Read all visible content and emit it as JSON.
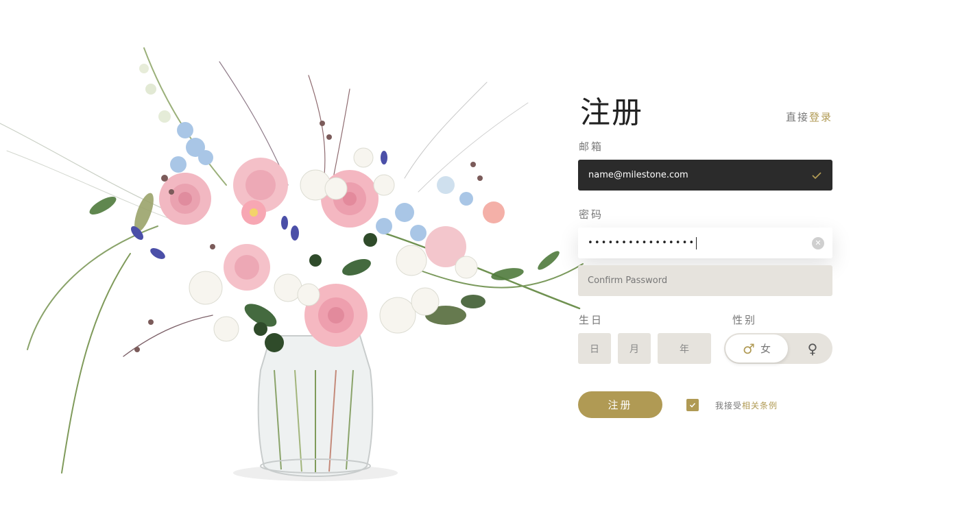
{
  "form": {
    "title": "注册",
    "login_prompt": "直接",
    "login_link": "登录",
    "email_label": "邮箱",
    "email_value": "name@milestone.com",
    "password_label": "密码",
    "password_value": "••••••••••••••••",
    "confirm_placeholder": "Confirm Password",
    "birthday_label": "生日",
    "birthday_day": "日",
    "birthday_month": "月",
    "birthday_year": "年",
    "gender_label": "性别",
    "gender_male_text": "女",
    "gender_male_symbol": "♂",
    "gender_female_symbol": "♀",
    "submit_label": "注册",
    "terms_prefix": "我接受",
    "terms_link": "相关条例",
    "terms_checked": true
  },
  "colors": {
    "accent": "#b09a54",
    "dark_field": "#2b2b2b",
    "light_field": "#e6e3dd"
  },
  "icons": {
    "email_valid": "check-icon",
    "password_clear": "clear-icon"
  }
}
